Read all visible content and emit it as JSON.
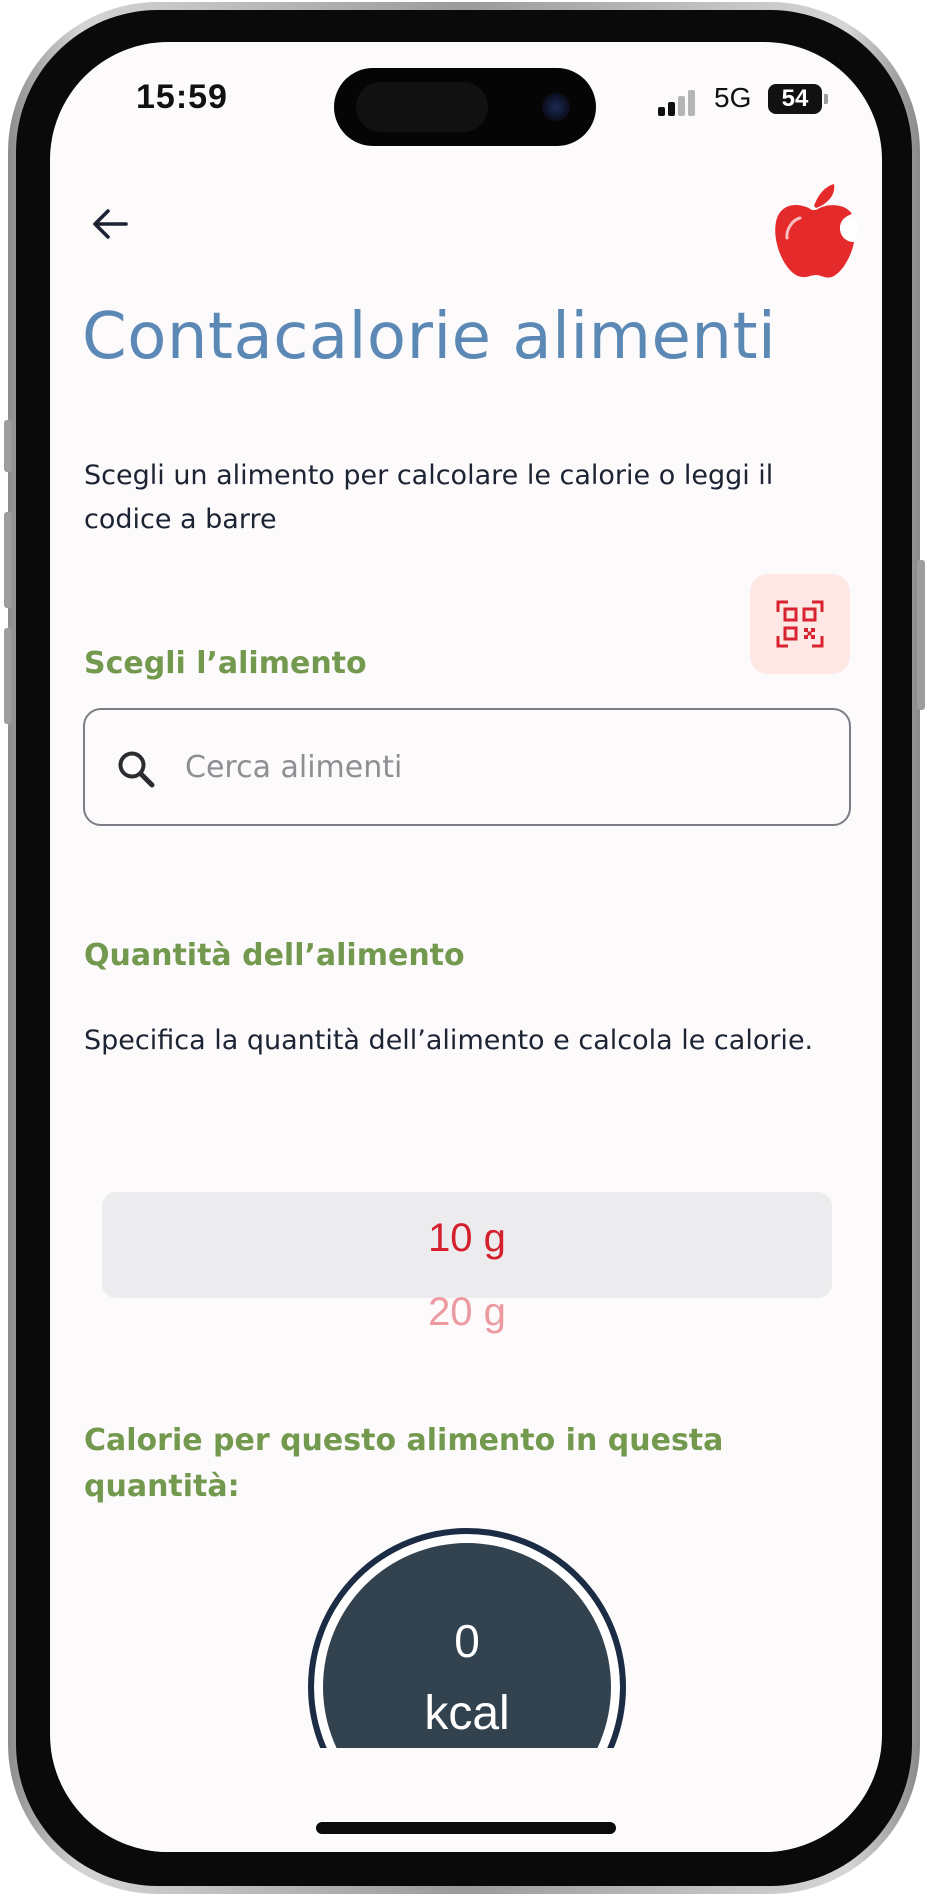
{
  "status_bar": {
    "time": "15:59",
    "network": "5G",
    "battery": "54"
  },
  "header": {
    "back_icon": "arrow-left-icon",
    "logo_icon": "apple-logo-icon"
  },
  "page": {
    "title": "Contacalorie alimenti",
    "subtitle": "Scegli un alimento per calcolare le calorie o leggi il codice a barre"
  },
  "food_section": {
    "label": "Scegli l’alimento",
    "qr_icon": "qr-code-icon",
    "search_placeholder": "Cerca alimenti",
    "search_value": ""
  },
  "quantity_section": {
    "label": "Quantità dell’alimento",
    "description": "Specifica la quantità dell’alimento e calcola le calorie.",
    "picker_options": [
      "10 g",
      "20 g"
    ],
    "selected": "10 g"
  },
  "calories_section": {
    "label": "Calorie per questo alimento in questa quantità:",
    "value": "0",
    "unit": "kcal"
  },
  "colors": {
    "title": "#5c88b5",
    "section_label": "#73994e",
    "accent_red": "#d4202c",
    "circle_fill": "#33424f"
  }
}
